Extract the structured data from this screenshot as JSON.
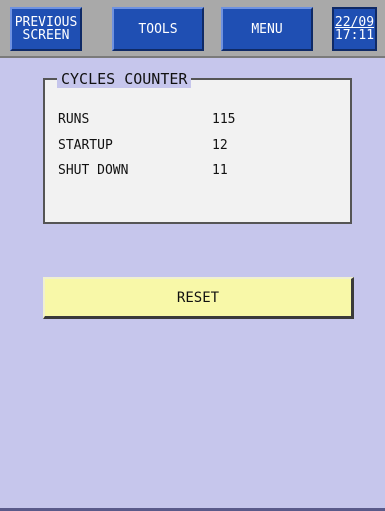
{
  "header": {
    "previous_screen": [
      "PREVIOUS",
      "SCREEN"
    ],
    "tools_label": "TOOLS",
    "menu_label": "MENU",
    "date": "22/09",
    "time": "17:11"
  },
  "cycles_counter": {
    "title": "CYCLES COUNTER",
    "rows": [
      {
        "label": "RUNS",
        "value": "115"
      },
      {
        "label": "STARTUP",
        "value": "12"
      },
      {
        "label": "SHUT DOWN",
        "value": "11"
      }
    ]
  },
  "actions": {
    "reset_label": "RESET"
  },
  "colors": {
    "background": "#c6c6ec",
    "nav_button": "#1f4fb3",
    "reset_button": "#f8f8a8",
    "panel": "#f2f2f2"
  }
}
